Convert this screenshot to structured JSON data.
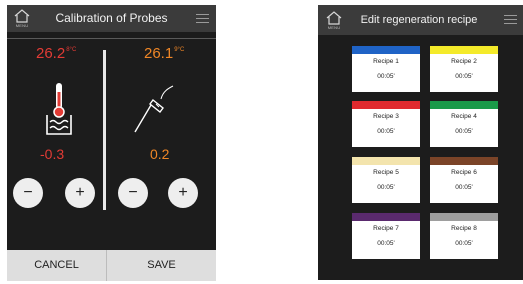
{
  "calibration": {
    "title": "Calibration of Probes",
    "menu_label": "MENU",
    "probe_left": {
      "temperature": "26.2",
      "unit": "8°C",
      "offset": "-0.3"
    },
    "probe_right": {
      "temperature": "26.1",
      "unit": "9°C",
      "offset": "0.2"
    },
    "minus": "−",
    "plus": "+",
    "cancel_label": "CANCEL",
    "save_label": "SAVE",
    "colors": {
      "left": "#e23b35",
      "right": "#ef8626"
    }
  },
  "regeneration": {
    "title": "Edit regeneration recipe",
    "menu_label": "MENU",
    "recipes": [
      {
        "name": "Recipe 1",
        "time": "00:05'",
        "color": "#1f63c6"
      },
      {
        "name": "Recipe 2",
        "time": "00:05'",
        "color": "#f4ea2a"
      },
      {
        "name": "Recipe 3",
        "time": "00:05'",
        "color": "#e02a2f"
      },
      {
        "name": "Recipe 4",
        "time": "00:05'",
        "color": "#1a9a49"
      },
      {
        "name": "Recipe 5",
        "time": "00:05'",
        "color": "#f3e4ad"
      },
      {
        "name": "Recipe 6",
        "time": "00:05'",
        "color": "#7b4428"
      },
      {
        "name": "Recipe 7",
        "time": "00:05'",
        "color": "#5a2a6e"
      },
      {
        "name": "Recipe 8",
        "time": "00:05'",
        "color": "#9e9e9e"
      }
    ]
  },
  "icons": [
    "home-menu-icon",
    "hamburger-icon",
    "thermometer-water-icon",
    "probe-needle-icon",
    "minus-icon",
    "plus-icon"
  ]
}
